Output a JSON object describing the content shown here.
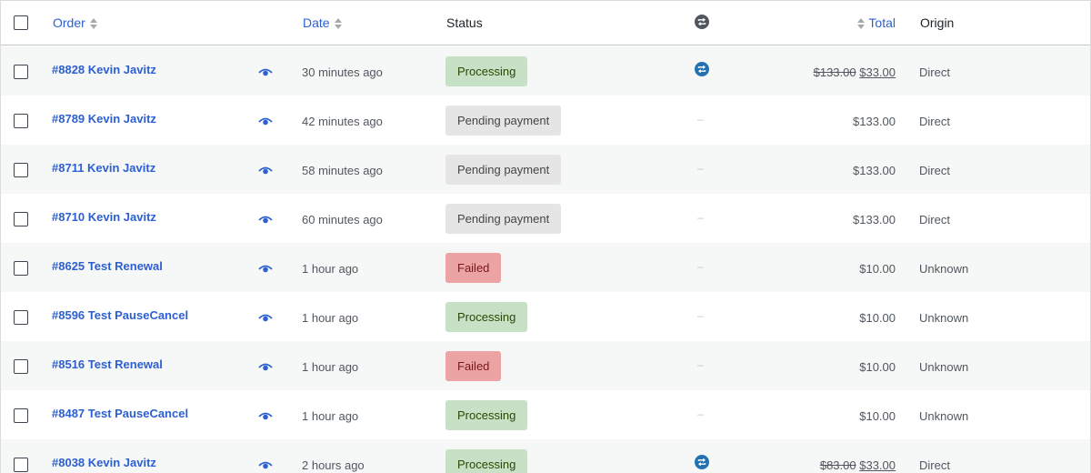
{
  "header": {
    "order": "Order",
    "date": "Date",
    "status": "Status",
    "total": "Total",
    "origin": "Origin"
  },
  "colors": {
    "link": "#2c5fd1",
    "processing_bg": "#c6e1c6",
    "pending_bg": "#e5e5e5",
    "failed_bg": "#eba3a3",
    "renew_icon": "#2271b1"
  },
  "icons": {
    "preview": "eye-icon",
    "subscription": "renewal-icon"
  },
  "orders": [
    {
      "order": "#8828 Kevin Javitz",
      "date": "30 minutes ago",
      "status": "Processing",
      "status_class": "processing",
      "subscription": true,
      "dash": "",
      "total_regular": "",
      "total_old": "$133.00",
      "total_new": "$33.00",
      "origin": "Direct"
    },
    {
      "order": "#8789 Kevin Javitz",
      "date": "42 minutes ago",
      "status": "Pending payment",
      "status_class": "pending",
      "subscription": false,
      "dash": "–",
      "total_regular": "$133.00",
      "total_old": "",
      "total_new": "",
      "origin": "Direct"
    },
    {
      "order": "#8711 Kevin Javitz",
      "date": "58 minutes ago",
      "status": "Pending payment",
      "status_class": "pending",
      "subscription": false,
      "dash": "–",
      "total_regular": "$133.00",
      "total_old": "",
      "total_new": "",
      "origin": "Direct"
    },
    {
      "order": "#8710 Kevin Javitz",
      "date": "60 minutes ago",
      "status": "Pending payment",
      "status_class": "pending",
      "subscription": false,
      "dash": "–",
      "total_regular": "$133.00",
      "total_old": "",
      "total_new": "",
      "origin": "Direct"
    },
    {
      "order": "#8625 Test Renewal",
      "date": "1 hour ago",
      "status": "Failed",
      "status_class": "failed",
      "subscription": false,
      "dash": "–",
      "total_regular": "$10.00",
      "total_old": "",
      "total_new": "",
      "origin": "Unknown"
    },
    {
      "order": "#8596 Test PauseCancel",
      "date": "1 hour ago",
      "status": "Processing",
      "status_class": "processing",
      "subscription": false,
      "dash": "–",
      "total_regular": "$10.00",
      "total_old": "",
      "total_new": "",
      "origin": "Unknown"
    },
    {
      "order": "#8516 Test Renewal",
      "date": "1 hour ago",
      "status": "Failed",
      "status_class": "failed",
      "subscription": false,
      "dash": "–",
      "total_regular": "$10.00",
      "total_old": "",
      "total_new": "",
      "origin": "Unknown"
    },
    {
      "order": "#8487 Test PauseCancel",
      "date": "1 hour ago",
      "status": "Processing",
      "status_class": "processing",
      "subscription": false,
      "dash": "–",
      "total_regular": "$10.00",
      "total_old": "",
      "total_new": "",
      "origin": "Unknown"
    },
    {
      "order": "#8038 Kevin Javitz",
      "date": "2 hours ago",
      "status": "Processing",
      "status_class": "processing",
      "subscription": true,
      "dash": "",
      "total_regular": "",
      "total_old": "$83.00",
      "total_new": "$33.00",
      "origin": "Direct"
    }
  ]
}
